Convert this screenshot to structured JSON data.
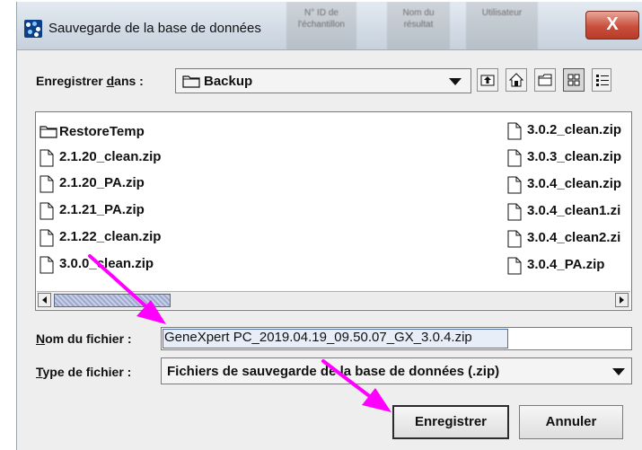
{
  "window": {
    "title": "Sauvegarde de la base de données",
    "close_glyph": "X",
    "background_headers": [
      "N° ID de l'échantillon",
      "Nom du résultat",
      "Utilisateur"
    ]
  },
  "location": {
    "label_before": "Enregistrer ",
    "label_mnemonic": "d",
    "label_after": "ans :",
    "folder": "Backup",
    "toolbar_icons": [
      "up-one-level-icon",
      "home-icon",
      "new-folder-icon",
      "list-view-icon",
      "details-view-icon"
    ]
  },
  "files": {
    "left_column": [
      {
        "name": "RestoreTemp",
        "icon": "folder-icon"
      },
      {
        "name": "2.1.20_clean.zip",
        "icon": "file-icon"
      },
      {
        "name": "2.1.20_PA.zip",
        "icon": "file-icon"
      },
      {
        "name": "2.1.21_PA.zip",
        "icon": "file-icon"
      },
      {
        "name": "2.1.22_clean.zip",
        "icon": "file-icon"
      },
      {
        "name": "3.0.0_clean.zip",
        "icon": "file-icon"
      }
    ],
    "right_column": [
      {
        "name": "3.0.2_clean.zip",
        "icon": "file-icon"
      },
      {
        "name": "3.0.3_clean.zip",
        "icon": "file-icon"
      },
      {
        "name": "3.0.4_clean.zip",
        "icon": "file-icon"
      },
      {
        "name": "3.0.4_clean1.zi",
        "icon": "file-icon"
      },
      {
        "name": "3.0.4_clean2.zi",
        "icon": "file-icon"
      },
      {
        "name": "3.0.4_PA.zip",
        "icon": "file-icon"
      }
    ]
  },
  "filename": {
    "label_mnemonic": "N",
    "label_after": "om du fichier :",
    "value": "GeneXpert PC_2019.04.19_09.50.07_GX_3.0.4.zip"
  },
  "filetype": {
    "label_mnemonic": "T",
    "label_after": "ype de fichier :",
    "value": "Fichiers de sauvegarde de la base de données (.zip)"
  },
  "buttons": {
    "save": "Enregistrer",
    "cancel": "Annuler"
  },
  "colors": {
    "annotation_arrow": "#ff00ff",
    "close_button": "#c9503d"
  }
}
